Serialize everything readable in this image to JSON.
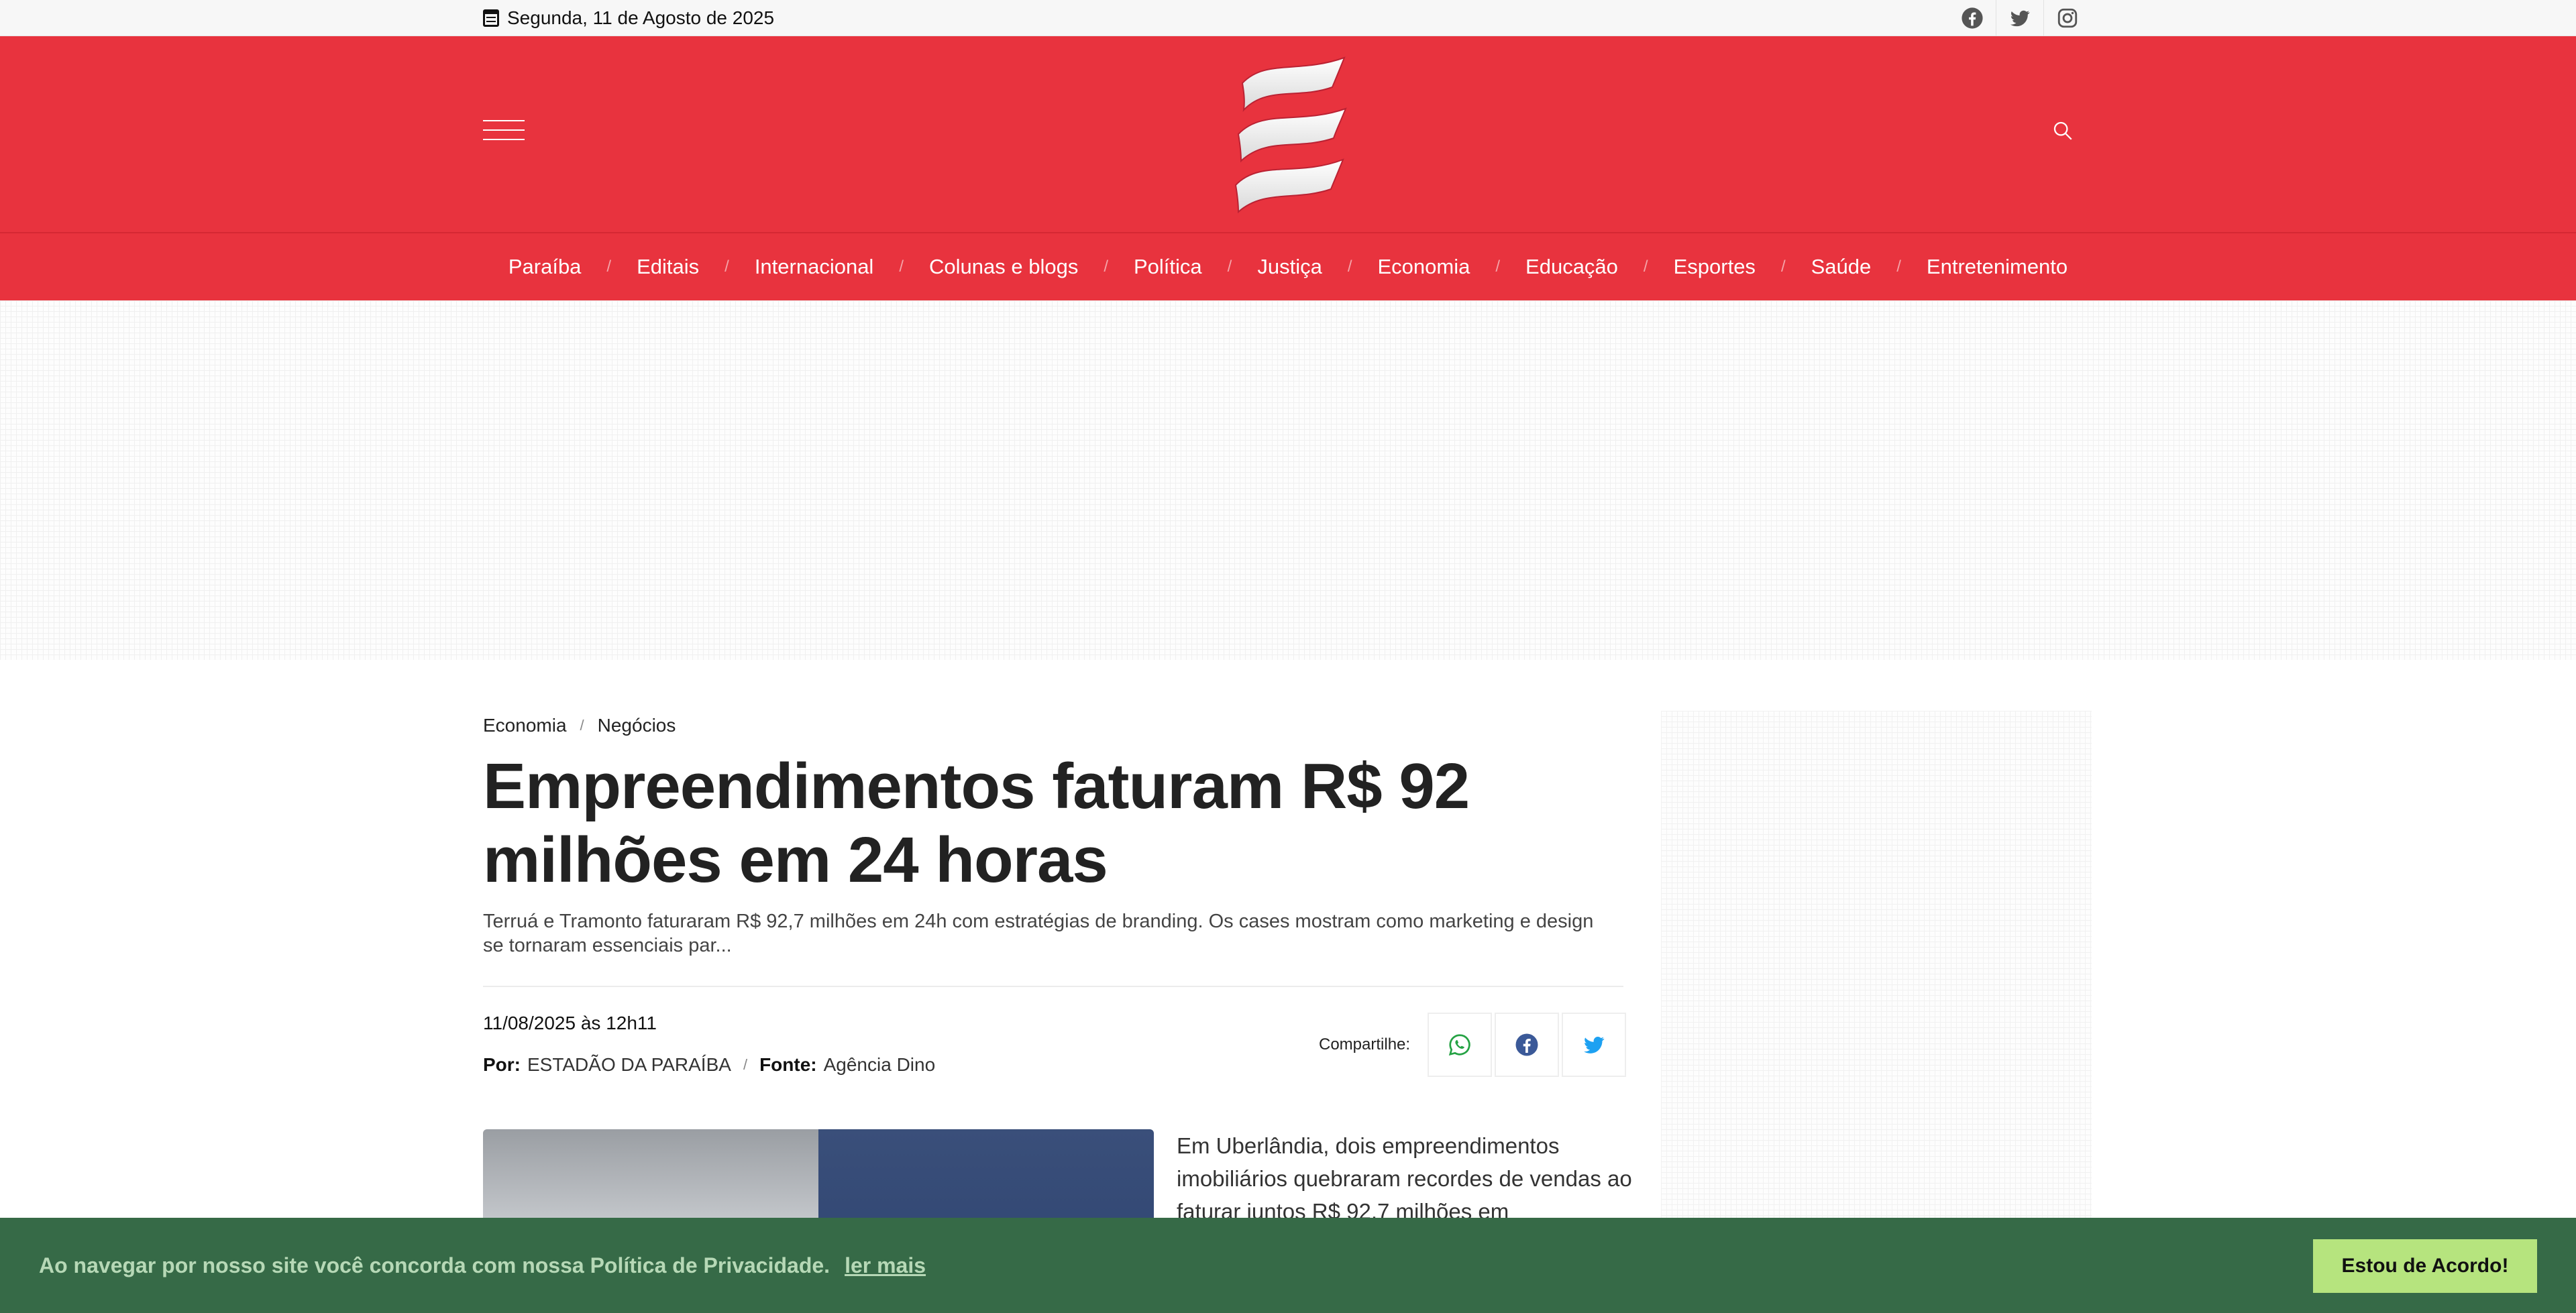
{
  "topbar": {
    "date": "Segunda, 11 de Agosto de 2025",
    "social": [
      "facebook-icon",
      "twitter-icon",
      "instagram-icon"
    ]
  },
  "header": {
    "logo": "estadao-da-paraiba-logo",
    "menu_icon": "hamburger-menu-icon",
    "search_icon": "search-icon",
    "colors": {
      "brand_red": "#e8333e",
      "cookie_green": "#366a47",
      "accept_green": "#b6e47e"
    }
  },
  "nav": {
    "items": [
      "Paraíba",
      "Editais",
      "Internacional",
      "Colunas e blogs",
      "Política",
      "Justiça",
      "Economia",
      "Educação",
      "Esportes",
      "Saúde",
      "Entretenimento"
    ],
    "separator": "/"
  },
  "article": {
    "breadcrumb": [
      "Economia",
      "Negócios"
    ],
    "breadcrumb_sep": "/",
    "title": "Empreendimentos faturam R$ 92 milhões em 24 horas",
    "lead": "Terruá e Tramonto faturaram R$ 92,7 milhões em 24h com estratégias de branding. Os cases mostram como marketing e design se tornaram essenciais par...",
    "datetime": "11/08/2025 às 12h11",
    "author_label": "Por:",
    "author": "ESTADÃO DA PARAÍBA",
    "source_label": "Fonte:",
    "source": "Agência Dino",
    "share_label": "Compartilhe:",
    "share_buttons": [
      "whatsapp-icon",
      "facebook-icon",
      "twitter-icon"
    ],
    "body_start": "Em Uberlândia, dois empreendimentos imobiliários quebraram recordes de vendas ao faturar juntos R$ 92,7 milhões em"
  },
  "cookie": {
    "message": "Ao navegar por nosso site você concorda com nossa Política de Privacidade.",
    "link": "ler mais",
    "accept": "Estou de Acordo!"
  }
}
